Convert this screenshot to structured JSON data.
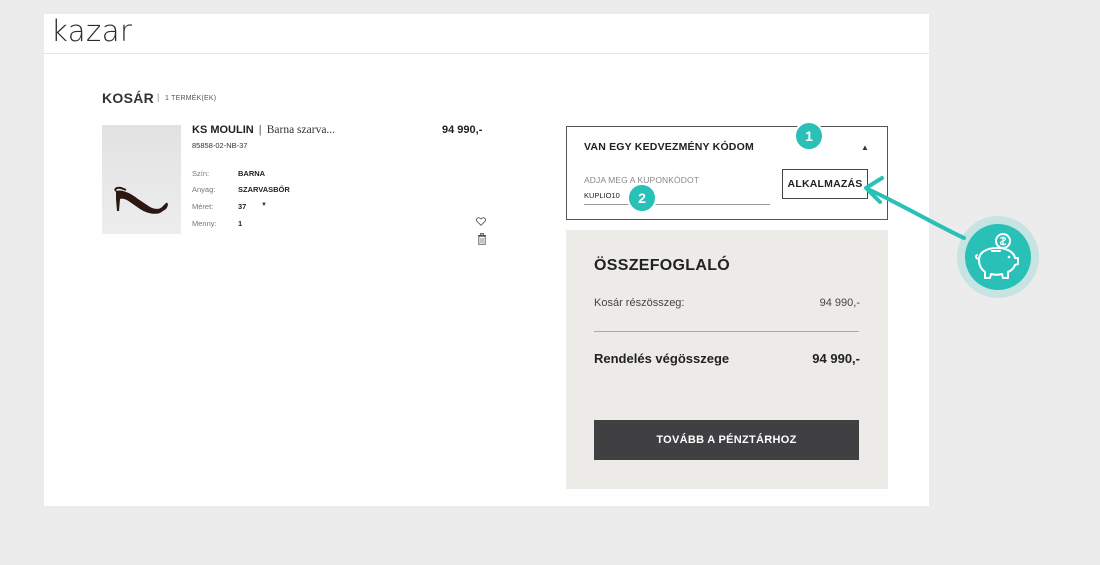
{
  "brand": {
    "logo": "kazar"
  },
  "cart": {
    "title": "KOSÁR",
    "separator": "|",
    "count": "1 TERMÉK(EK)"
  },
  "product": {
    "name": "KS MOULIN",
    "separator": "|",
    "subtitle": "Barna szarva...",
    "sku": "85858-02-NB-37",
    "price": "94 990,-",
    "attributes": [
      {
        "label": "Szín:",
        "value": "BARNA"
      },
      {
        "label": "Anyag:",
        "value": "SZARVASBŐR"
      },
      {
        "label": "Méret:",
        "value": "37"
      },
      {
        "label": "Menny:",
        "value": "1"
      }
    ],
    "icons": [
      "heart-icon",
      "trash-icon"
    ]
  },
  "coupon": {
    "title": "VAN EGY KEDVEZMÉNY KÓDOM",
    "placeholder": "ADJA MEG A KUPONKÓDOT",
    "value": "KUPLIO10",
    "apply_label": "ALKALMAZÁS"
  },
  "badges": [
    "1",
    "2"
  ],
  "summary": {
    "title": "ÖSSZEFOGLALÓ",
    "subtotal_label": "Kosár részösszeg:",
    "subtotal_value": "94 990,-",
    "total_label": "Rendelés végösszege",
    "total_value": "94 990,-",
    "checkout_label": "TOVÁBB A PÉNZTÁRHOZ"
  },
  "colors": {
    "accent": "#29c0b8",
    "button_dark": "#404043",
    "summary_bg": "#edebe7"
  }
}
